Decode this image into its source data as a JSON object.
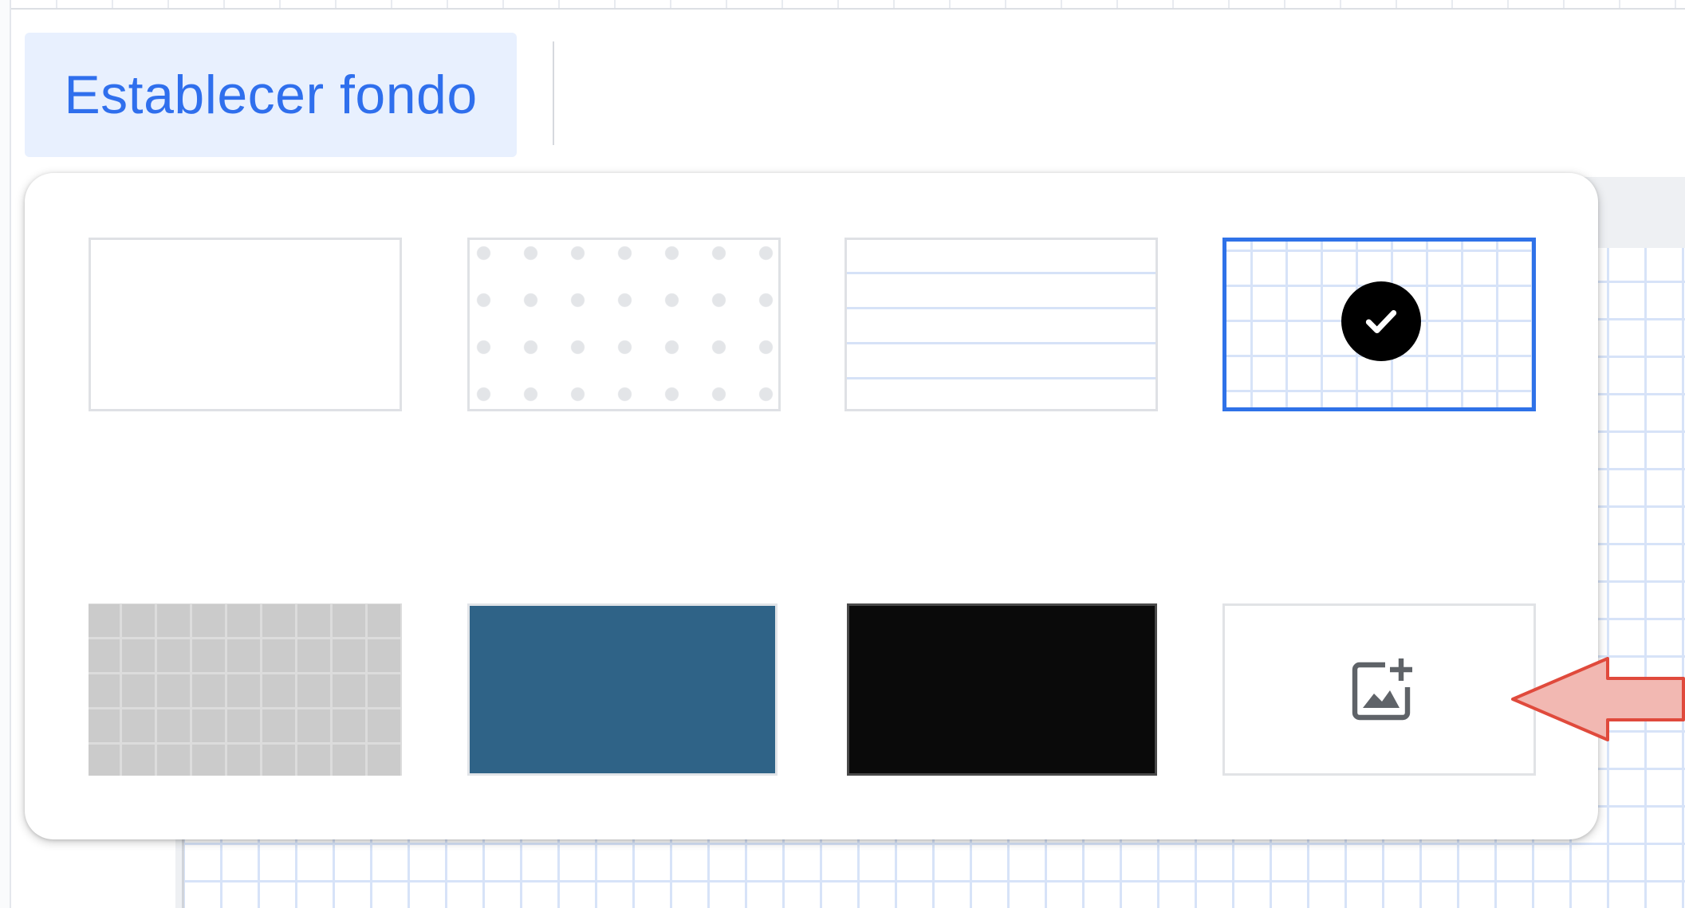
{
  "toolbar": {
    "set_background_label": "Establecer fondo"
  },
  "background_options": [
    {
      "name": "blank",
      "selected": false
    },
    {
      "name": "dots",
      "selected": false
    },
    {
      "name": "lines",
      "selected": false
    },
    {
      "name": "grid",
      "selected": true
    },
    {
      "name": "gray-grid",
      "selected": false
    },
    {
      "name": "blue",
      "selected": false,
      "color": "#2f6387"
    },
    {
      "name": "black",
      "selected": false,
      "color": "#0a0a0a"
    },
    {
      "name": "upload-image",
      "selected": false
    }
  ],
  "icons": {
    "selected": "check-circle-icon",
    "upload": "add-image-icon",
    "annotation": "arrow-left"
  },
  "colors": {
    "accent": "#2f72e8",
    "button_bg": "#e8f0fe",
    "button_text": "#2f6fed",
    "annotation_fill": "#f2b8b2",
    "annotation_stroke": "#e04a3c"
  }
}
